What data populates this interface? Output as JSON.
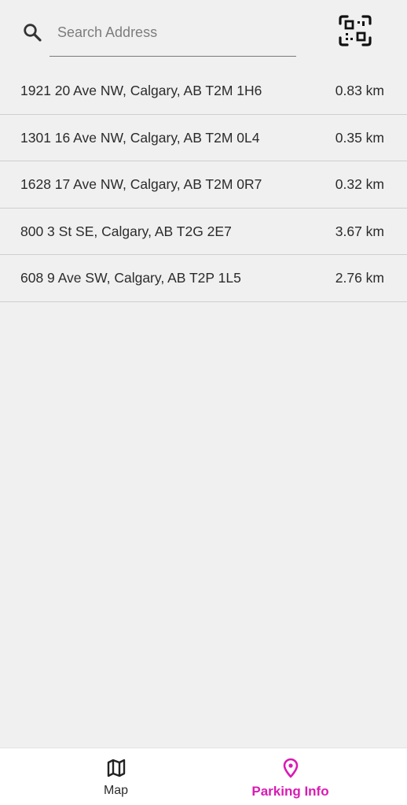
{
  "search": {
    "placeholder": "Search Address",
    "value": ""
  },
  "icons": {
    "search": "search-icon",
    "qr": "qr-code-scan-icon",
    "map": "map-icon",
    "parking": "location-pin-icon"
  },
  "addresses": [
    {
      "address": "1921 20 Ave NW, Calgary, AB T2M 1H6",
      "distance": "0.83 km"
    },
    {
      "address": "1301 16 Ave NW, Calgary, AB T2M 0L4",
      "distance": "0.35 km"
    },
    {
      "address": "1628 17 Ave NW, Calgary, AB T2M 0R7",
      "distance": "0.32 km"
    },
    {
      "address": "800 3 St SE, Calgary, AB T2G 2E7",
      "distance": "3.67 km"
    },
    {
      "address": "608 9 Ave SW, Calgary, AB T2P 1L5",
      "distance": "2.76 km"
    }
  ],
  "nav": {
    "map_label": "Map",
    "parking_label": "Parking Info",
    "active": "parking"
  },
  "colors": {
    "accent": "#d91bb3",
    "background": "#f0f0f0",
    "text": "#2b2b2b"
  }
}
